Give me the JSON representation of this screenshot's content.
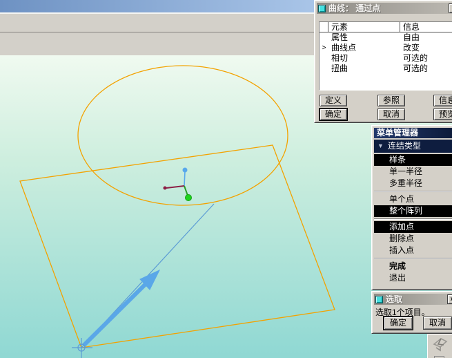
{
  "colors": {
    "titlebar_blue_left": "#6e92c3",
    "titlebar_blue_right": "#a9c5e8",
    "toolbar_gray": "#d3d0c9",
    "dialog_bg": "#d4d0c8",
    "dialog_title_left": "#8f8c86",
    "dialog_title_right": "#bcb9b2",
    "mm_title": "#22386b",
    "mm_header": "#0e1d3f",
    "highlight_bg": "#000000",
    "viewport_top": "#f0faf0",
    "viewport_bottom": "#8fd8d3",
    "orange": "#f3a200",
    "blue_line": "#5b9bd5",
    "arrow_blue": "#5aa7e8",
    "green": "#1ed51e",
    "maroon": "#8c1f45",
    "point_blue": "#58a8ec",
    "icon_cyan": "#45e0e0"
  },
  "curve_dialog": {
    "title": "曲线： 通过点",
    "close": "×",
    "table": {
      "headers": {
        "element": "元素",
        "info": "信息"
      },
      "rows": [
        {
          "marker": "",
          "element": "属性",
          "info": "自由"
        },
        {
          "marker": ">",
          "element": "曲线点",
          "info": "改变"
        },
        {
          "marker": "",
          "element": "相切",
          "info": "可选的"
        },
        {
          "marker": "",
          "element": "扭曲",
          "info": "可选的"
        }
      ]
    },
    "buttons": {
      "define": "定义",
      "refs": "参照",
      "info": "信息",
      "ok": "确定",
      "cancel": "取消",
      "preview": "预览"
    }
  },
  "menu_manager": {
    "title": "菜单管理器",
    "section": {
      "arrow": "▼",
      "label": "连结类型"
    },
    "items": [
      {
        "label": "样条",
        "highlighted": true
      },
      {
        "label": "单一半径",
        "highlighted": false
      },
      {
        "label": "多重半径",
        "highlighted": false
      },
      {
        "label": "单个点",
        "highlighted": false
      },
      {
        "label": "整个阵列",
        "highlighted": true
      },
      {
        "label": "添加点",
        "highlighted": true
      },
      {
        "label": "删除点",
        "highlighted": false
      },
      {
        "label": "插入点",
        "highlighted": false
      },
      {
        "label": "完成",
        "highlighted": false,
        "bold": true
      },
      {
        "label": "退出",
        "highlighted": false
      }
    ]
  },
  "select_dialog": {
    "title": "选取",
    "close": "×",
    "message": "选取1个项目。",
    "ok": "确定",
    "cancel": "取消"
  },
  "canvas": {
    "shapes": [
      "ellipse-sketch",
      "plane-quadrilateral",
      "datum-curve",
      "direction-arrow",
      "origin-crosshair",
      "curve-points-triad"
    ]
  }
}
